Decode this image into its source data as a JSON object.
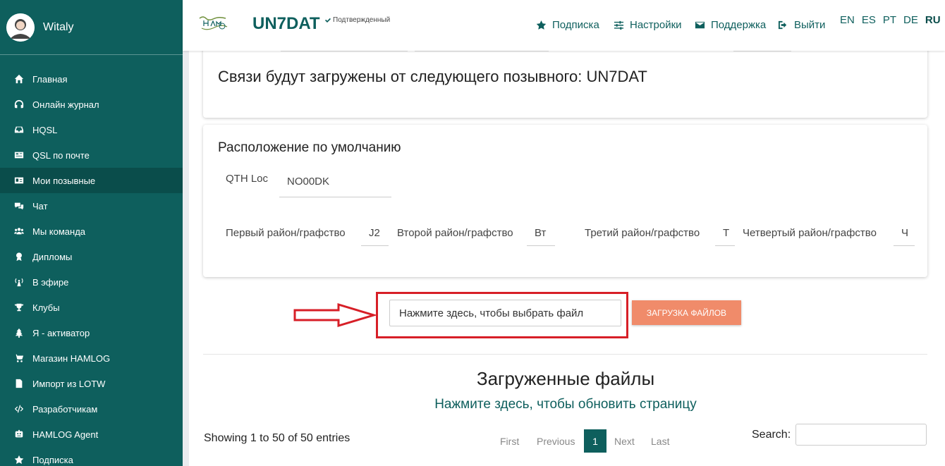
{
  "user": {
    "name": "Witaly"
  },
  "sidebar": {
    "items": [
      {
        "label": "Главная",
        "icon": "home-icon"
      },
      {
        "label": "Онлайн журнал",
        "icon": "headset-icon"
      },
      {
        "label": "HQSL",
        "icon": "inbox-icon"
      },
      {
        "label": "QSL по почте",
        "icon": "card-icon"
      },
      {
        "label": "Мои позывные",
        "icon": "id-card-icon",
        "active": true
      },
      {
        "label": "Чат",
        "icon": "chat-icon"
      },
      {
        "label": "Мы команда",
        "icon": "users-icon"
      },
      {
        "label": "Дипломы",
        "icon": "award-icon"
      },
      {
        "label": "В эфире",
        "icon": "broadcast-icon"
      },
      {
        "label": "Клубы",
        "icon": "trophy-icon"
      },
      {
        "label": "Я - активатор",
        "icon": "tree-icon"
      },
      {
        "label": "Магазин HAMLOG",
        "icon": "cart-icon"
      },
      {
        "label": "Импорт из LOTW",
        "icon": "file-import-icon"
      },
      {
        "label": "Разработчикам",
        "icon": "code-icon"
      },
      {
        "label": "HAMLOG Agent",
        "icon": "robot-icon"
      },
      {
        "label": "Подписка",
        "icon": "star-icon"
      }
    ]
  },
  "header": {
    "callsign": "UN7DAT",
    "verified": "Подтвержденный",
    "nav": {
      "subscription": "Подписка",
      "settings": "Настройки",
      "support": "Поддержка",
      "logout": "Выйти"
    },
    "languages": [
      "EN",
      "ES",
      "PT",
      "DE",
      "RU"
    ],
    "current_language": "RU"
  },
  "upload_info": {
    "text": "Связи будут загружены от следующего позывного: UN7DAT"
  },
  "default_location": {
    "title": "Расположение по умолчанию",
    "qth_label": "QTH Loc",
    "qth_value": "NO00DK",
    "district1_label": "Первый район/графство",
    "district1_value": "J2",
    "district2_label": "Второй район/графство",
    "district2_value": "Вт",
    "district3_label": "Третий район/графство",
    "district3_value": "Т",
    "district4_label": "Четвертый район/графство",
    "district4_value": "Ч"
  },
  "upload": {
    "file_placeholder": "Нажмите здесь, чтобы выбрать файл",
    "button": "ЗАГРУЗКА ФАЙЛОВ"
  },
  "files": {
    "title": "Загруженные файлы",
    "refresh": "Нажмите здесь, чтобы обновить страницу",
    "entries_info": "Showing 1 to 50 of 50 entries",
    "pagination": {
      "first": "First",
      "previous": "Previous",
      "current": "1",
      "next": "Next",
      "last": "Last"
    },
    "search_label": "Search:"
  },
  "colors": {
    "brand": "#0e5f5d",
    "upload_button": "#f08b6a",
    "highlight": "#d71f27"
  }
}
